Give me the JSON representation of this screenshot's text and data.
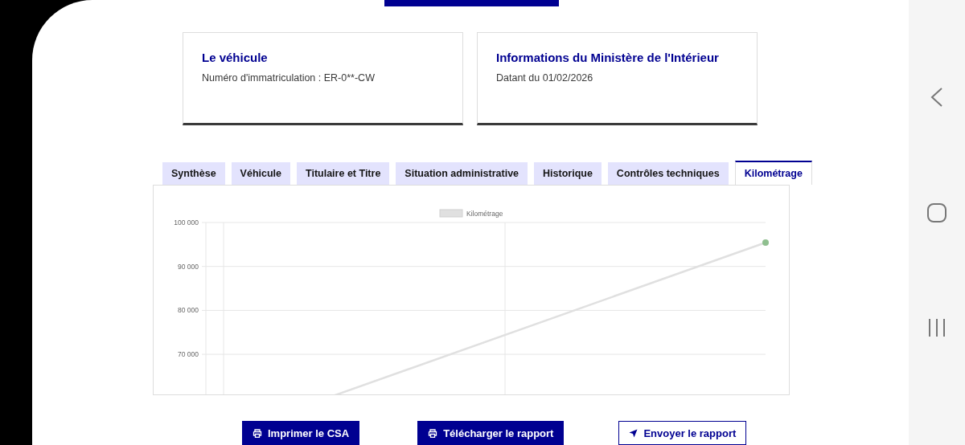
{
  "cards": [
    {
      "title": "Le véhicule",
      "text": "Numéro d'immatriculation : ER-0**-CW"
    },
    {
      "title": "Informations du Ministère de l'Intérieur",
      "text": "Datant du 01/02/2026"
    }
  ],
  "tabs": [
    {
      "label": "Synthèse",
      "selected": false
    },
    {
      "label": "Véhicule",
      "selected": false
    },
    {
      "label": "Titulaire et Titre",
      "selected": false
    },
    {
      "label": "Situation administrative",
      "selected": false
    },
    {
      "label": "Historique",
      "selected": false
    },
    {
      "label": "Contrôles techniques",
      "selected": false
    },
    {
      "label": "Kilométrage",
      "selected": true
    }
  ],
  "chart": {
    "legend": "Kilométrage",
    "y_axis_labels": [
      "100 000",
      "90 000",
      "80 000",
      "70 000"
    ]
  },
  "buttons": [
    {
      "kind": "print",
      "label": "Imprimer le CSA"
    },
    {
      "kind": "print",
      "label": "Télécharger le rapport"
    },
    {
      "kind": "send",
      "label": "Envoyer le rapport"
    }
  ]
}
